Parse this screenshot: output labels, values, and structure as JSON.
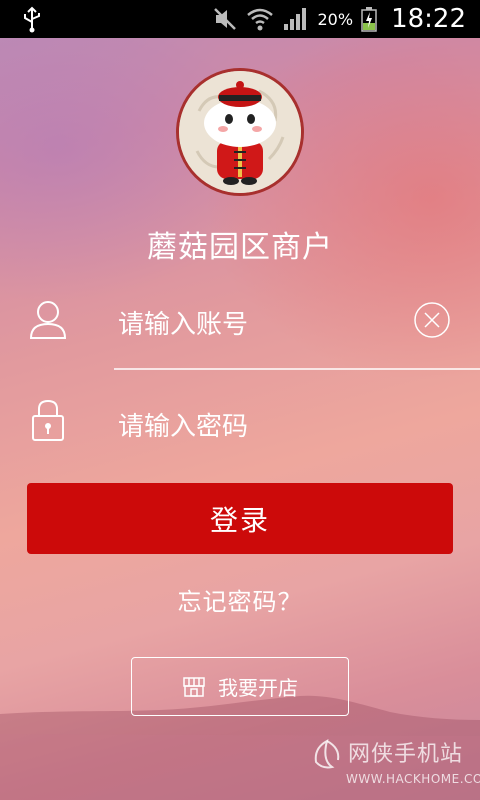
{
  "status_bar": {
    "battery_percent": "20%",
    "time": "18:22"
  },
  "app": {
    "title": "蘑菇园区商户"
  },
  "login_form": {
    "account_placeholder": "请输入账号",
    "password_placeholder": "请输入密码",
    "login_label": "登录",
    "forgot_label": "忘记密码？"
  },
  "footer": {
    "open_store_label": "我要开店"
  },
  "watermark": {
    "name": "网侠手机站",
    "url": "WWW.HACKHOME.COM"
  },
  "colors": {
    "primary_red": "#cc0a0a",
    "status_bar": "#000000",
    "text": "#ffffff"
  }
}
